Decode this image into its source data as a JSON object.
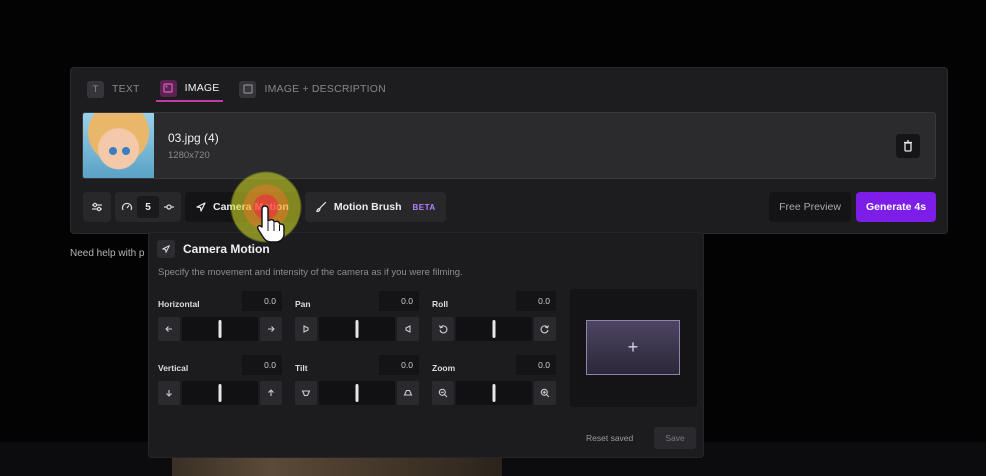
{
  "tabs": [
    {
      "label": "TEXT",
      "icon": "text-icon"
    },
    {
      "label": "IMAGE",
      "icon": "image-icon"
    },
    {
      "label": "IMAGE + DESCRIPTION",
      "icon": "image-description-icon"
    }
  ],
  "active_tab": "IMAGE",
  "file": {
    "name": "03.jpg (4)",
    "resolution": "1280x720"
  },
  "toolbar": {
    "duration_value": "5",
    "camera_motion_label": "Camera Motion",
    "motion_brush_label": "Motion Brush",
    "beta_label": "BETA",
    "free_preview_label": "Free Preview",
    "generate_label": "Generate 4s"
  },
  "help_text": "Need help with p",
  "camera_motion": {
    "title": "Camera Motion",
    "description": "Specify the movement and intensity of the camera as if you were filming.",
    "controls": {
      "horizontal": {
        "label": "Horizontal",
        "value": "0.0"
      },
      "pan": {
        "label": "Pan",
        "value": "0.0"
      },
      "roll": {
        "label": "Roll",
        "value": "0.0"
      },
      "vertical": {
        "label": "Vertical",
        "value": "0.0"
      },
      "tilt": {
        "label": "Tilt",
        "value": "0.0"
      },
      "zoom": {
        "label": "Zoom",
        "value": "0.0"
      }
    },
    "preview_plus": "+",
    "reset_label": "Reset saved",
    "save_label": "Save"
  },
  "colors": {
    "accent_purple": "#7d1ee8",
    "active_tab_pink": "#c23aa4",
    "beta_text": "#b580ff"
  }
}
